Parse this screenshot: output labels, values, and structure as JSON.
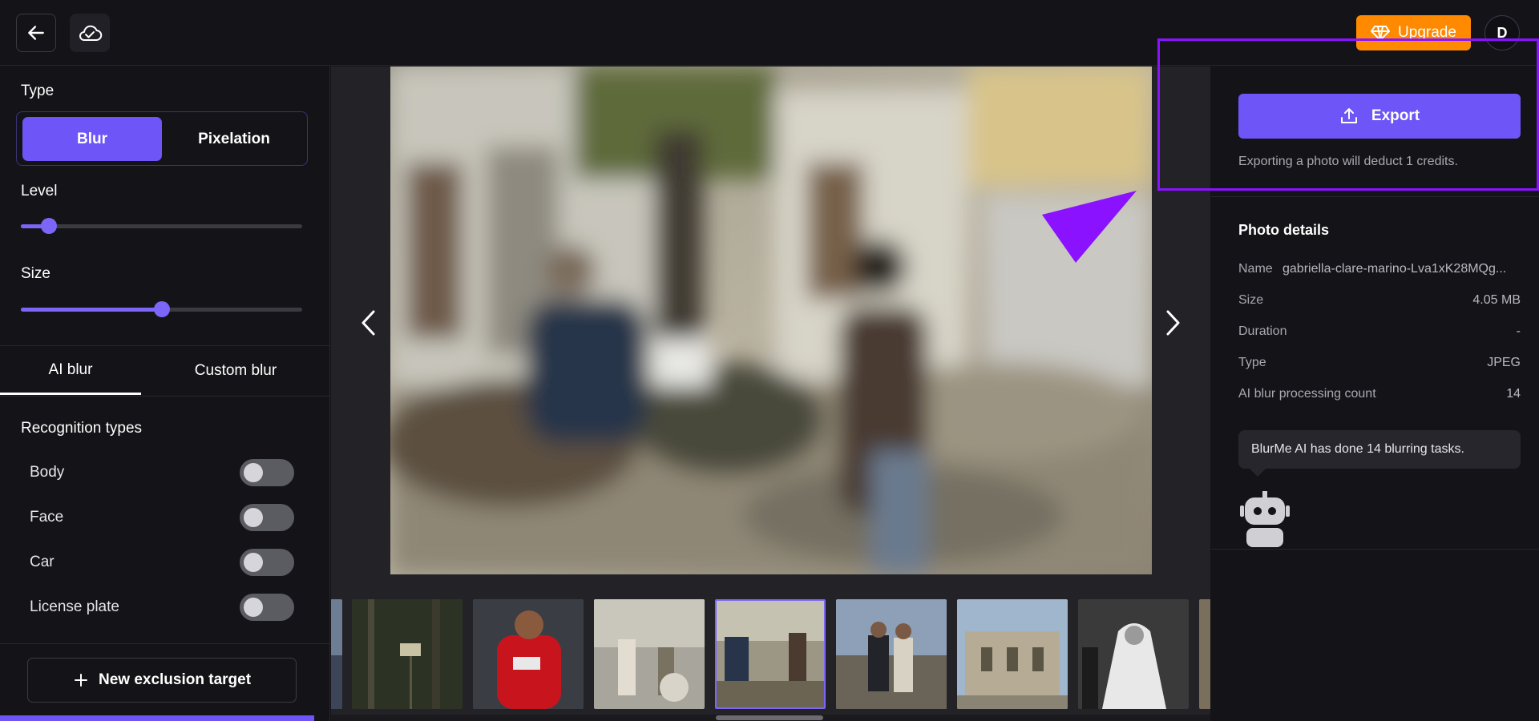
{
  "header": {
    "back_icon": "arrow-left-icon",
    "cloud_icon": "cloud-check-icon",
    "upgrade_label": "Upgrade",
    "upgrade_icon": "diamond-icon",
    "avatar_initial": "D",
    "colors": {
      "upgrade": "#ff8a00",
      "accent": "#6e55f7"
    }
  },
  "left_panel": {
    "type_label": "Type",
    "type_options": [
      "Blur",
      "Pixelation"
    ],
    "selected_type": "Blur",
    "level_label": "Level",
    "level_value": 0.1,
    "size_label": "Size",
    "size_value": 0.5,
    "tabs": [
      "AI blur",
      "Custom blur"
    ],
    "active_tab": "AI blur",
    "recognition_title": "Recognition types",
    "recognition_types": [
      {
        "label": "Body",
        "enabled": false
      },
      {
        "label": "Face",
        "enabled": false
      },
      {
        "label": "Car",
        "enabled": false
      },
      {
        "label": "License plate",
        "enabled": false
      }
    ],
    "new_exclusion_label": "New exclusion target"
  },
  "center": {
    "prev_icon": "chevron-left-icon",
    "next_icon": "chevron-right-icon",
    "thumbnails": [
      "thumbnail-partial",
      "thumbnail-forest-sign",
      "thumbnail-football-player",
      "thumbnail-street-couple",
      "thumbnail-market-scene",
      "thumbnail-couple-portrait",
      "thumbnail-old-building",
      "thumbnail-wedding",
      "thumbnail-partial-right"
    ],
    "active_thumbnail": 4
  },
  "right_panel": {
    "export_label": "Export",
    "export_icon": "upload-icon",
    "export_note": "Exporting a photo will deduct 1 credits.",
    "details_title": "Photo details",
    "details": [
      {
        "key": "Name",
        "value": "gabriella-clare-marino-Lva1xK28MQg..."
      },
      {
        "key": "Size",
        "value": "4.05 MB"
      },
      {
        "key": "Duration",
        "value": "-"
      },
      {
        "key": "Type",
        "value": "JPEG"
      },
      {
        "key": "AI blur processing count",
        "value": "14"
      }
    ],
    "assistant_message": "BlurMe AI has done 14 blurring tasks.",
    "assistant_icon": "robot-icon"
  }
}
